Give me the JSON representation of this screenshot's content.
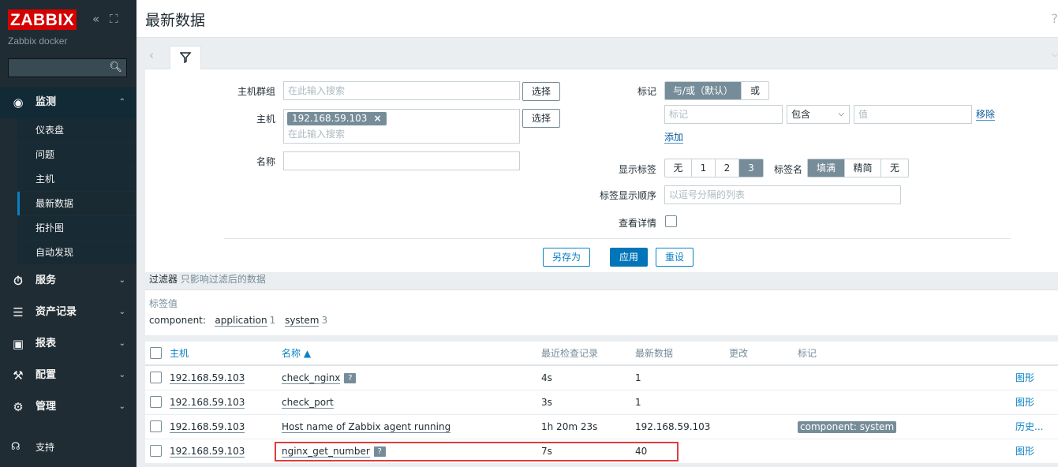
{
  "sidebar": {
    "logo": "ZABBIX",
    "server_name": "Zabbix docker",
    "collapse_icon": "«",
    "kiosk_icon": "⛶",
    "sections": [
      {
        "label": "监测",
        "icon": "eye-icon",
        "open": true
      },
      {
        "label": "服务",
        "icon": "clock-icon"
      },
      {
        "label": "资产记录",
        "icon": "list-icon"
      },
      {
        "label": "报表",
        "icon": "chart-icon"
      },
      {
        "label": "配置",
        "icon": "wrench-icon"
      },
      {
        "label": "管理",
        "icon": "gear-icon"
      }
    ],
    "monitoring_items": [
      "仪表盘",
      "问题",
      "主机",
      "最新数据",
      "拓扑图",
      "自动发现"
    ],
    "active_item": "最新数据",
    "support": "支持"
  },
  "header": {
    "title": "最新数据",
    "help": "?"
  },
  "filter": {
    "host_groups_label": "主机群组",
    "host_groups_placeholder": "在此输入搜索",
    "select_label": "选择",
    "hosts_label": "主机",
    "host_chip": "192.168.59.103",
    "host_chip_remove": "×",
    "hosts_placeholder": "在此输入搜索",
    "name_label": "名称",
    "tags_label": "标记",
    "tags_andor": "与/或（默认）",
    "tags_or": "或",
    "tag_placeholder": "标记",
    "tag_operator": "包含",
    "value_placeholder": "值",
    "remove_label": "移除",
    "add_label": "添加",
    "show_tags_label": "显示标签",
    "show_tags_options": [
      "无",
      "1",
      "2",
      "3"
    ],
    "show_tags_selected": "3",
    "tag_name_label": "标签名",
    "tag_name_options": [
      "填满",
      "精简",
      "无"
    ],
    "tag_name_selected": "填满",
    "tag_order_label": "标签显示顺序",
    "tag_order_placeholder": "以逗号分隔的列表",
    "show_details_label": "查看详情",
    "save_as": "另存为",
    "apply": "应用",
    "reset": "重设",
    "note_title": "过滤器",
    "note_text": "只影响过滤后的数据"
  },
  "tag_values": {
    "title": "标签值",
    "key": "component:",
    "values": [
      {
        "name": "application",
        "count": "1"
      },
      {
        "name": "system",
        "count": "3"
      }
    ]
  },
  "table": {
    "headers": {
      "host": "主机",
      "name": "名称 ▲",
      "last_check": "最近检查记录",
      "last_value": "最新数据",
      "change": "更改",
      "tags": "标记"
    },
    "rows": [
      {
        "host": "192.168.59.103",
        "name": "check_nginx",
        "help": "?",
        "last_check": "4s",
        "last_value": "1",
        "tag": "",
        "action": "图形"
      },
      {
        "host": "192.168.59.103",
        "name": "check_port",
        "help": "",
        "last_check": "3s",
        "last_value": "1",
        "tag": "",
        "action": "图形"
      },
      {
        "host": "192.168.59.103",
        "name": "Host name of Zabbix agent running",
        "help": "",
        "last_check": "1h 20m 23s",
        "last_value": "192.168.59.103",
        "tag": "component: system",
        "action": "历史..."
      },
      {
        "host": "192.168.59.103",
        "name": "nginx_get_number",
        "help": "?",
        "last_check": "7s",
        "last_value": "40",
        "tag": "",
        "action": "图形"
      }
    ]
  }
}
